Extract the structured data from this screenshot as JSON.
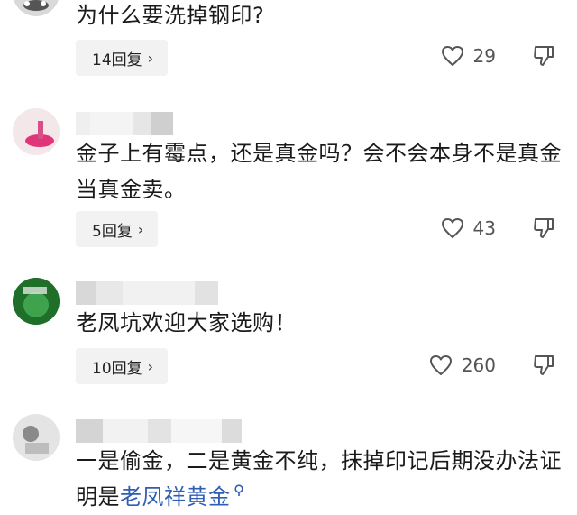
{
  "comments": [
    {
      "text": "为什么要洗掉钢印?",
      "reply_label": "14回复",
      "likes": "29"
    },
    {
      "text": "金子上有霉点，还是真金吗？会不会本身不是真金当真金卖。",
      "reply_label": "5回复",
      "likes": "43"
    },
    {
      "text": "老凤坑欢迎大家选购！",
      "reply_label": "10回复",
      "likes": "260"
    },
    {
      "text_plain": "一是偷金，二是黄金不纯，抹掉印记后期没办法证明是",
      "text_link": "老凤祥黄金",
      "link_icon": "search-icon"
    }
  ],
  "icons": {
    "chevron": "chevron-right-icon",
    "like": "heart-icon",
    "dislike": "thumbs-down-icon"
  },
  "colors": {
    "reply_bg": "#f2f2f2",
    "link": "#2f5fb3",
    "text": "#1a1a1a",
    "meta": "#555555"
  }
}
